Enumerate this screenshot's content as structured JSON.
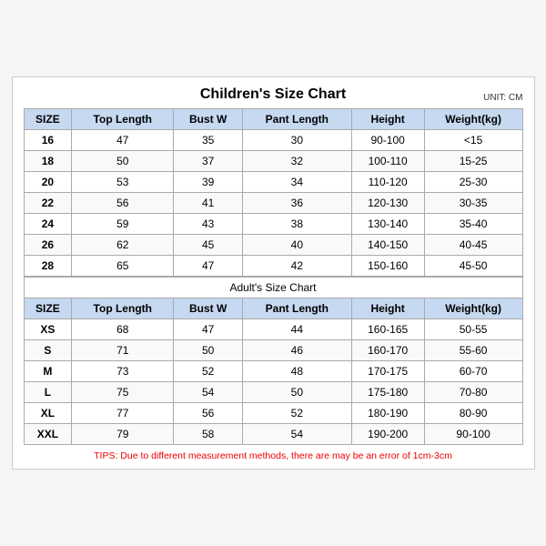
{
  "chart": {
    "children": {
      "title": "Children's Size Chart",
      "unit": "UNIT: CM",
      "headers": [
        "SIZE",
        "Top Length",
        "Bust W",
        "Pant Length",
        "Height",
        "Weight(kg)"
      ],
      "rows": [
        [
          "16",
          "47",
          "35",
          "30",
          "90-100",
          "<15"
        ],
        [
          "18",
          "50",
          "37",
          "32",
          "100-110",
          "15-25"
        ],
        [
          "20",
          "53",
          "39",
          "34",
          "110-120",
          "25-30"
        ],
        [
          "22",
          "56",
          "41",
          "36",
          "120-130",
          "30-35"
        ],
        [
          "24",
          "59",
          "43",
          "38",
          "130-140",
          "35-40"
        ],
        [
          "26",
          "62",
          "45",
          "40",
          "140-150",
          "40-45"
        ],
        [
          "28",
          "65",
          "47",
          "42",
          "150-160",
          "45-50"
        ]
      ]
    },
    "adults": {
      "title": "Adult's Size Chart",
      "headers": [
        "SIZE",
        "Top Length",
        "Bust W",
        "Pant Length",
        "Height",
        "Weight(kg)"
      ],
      "rows": [
        [
          "XS",
          "68",
          "47",
          "44",
          "160-165",
          "50-55"
        ],
        [
          "S",
          "71",
          "50",
          "46",
          "160-170",
          "55-60"
        ],
        [
          "M",
          "73",
          "52",
          "48",
          "170-175",
          "60-70"
        ],
        [
          "L",
          "75",
          "54",
          "50",
          "175-180",
          "70-80"
        ],
        [
          "XL",
          "77",
          "56",
          "52",
          "180-190",
          "80-90"
        ],
        [
          "XXL",
          "79",
          "58",
          "54",
          "190-200",
          "90-100"
        ]
      ]
    },
    "tips": "TIPS: Due to different measurement methods, there are may be an error of 1cm-3cm"
  }
}
